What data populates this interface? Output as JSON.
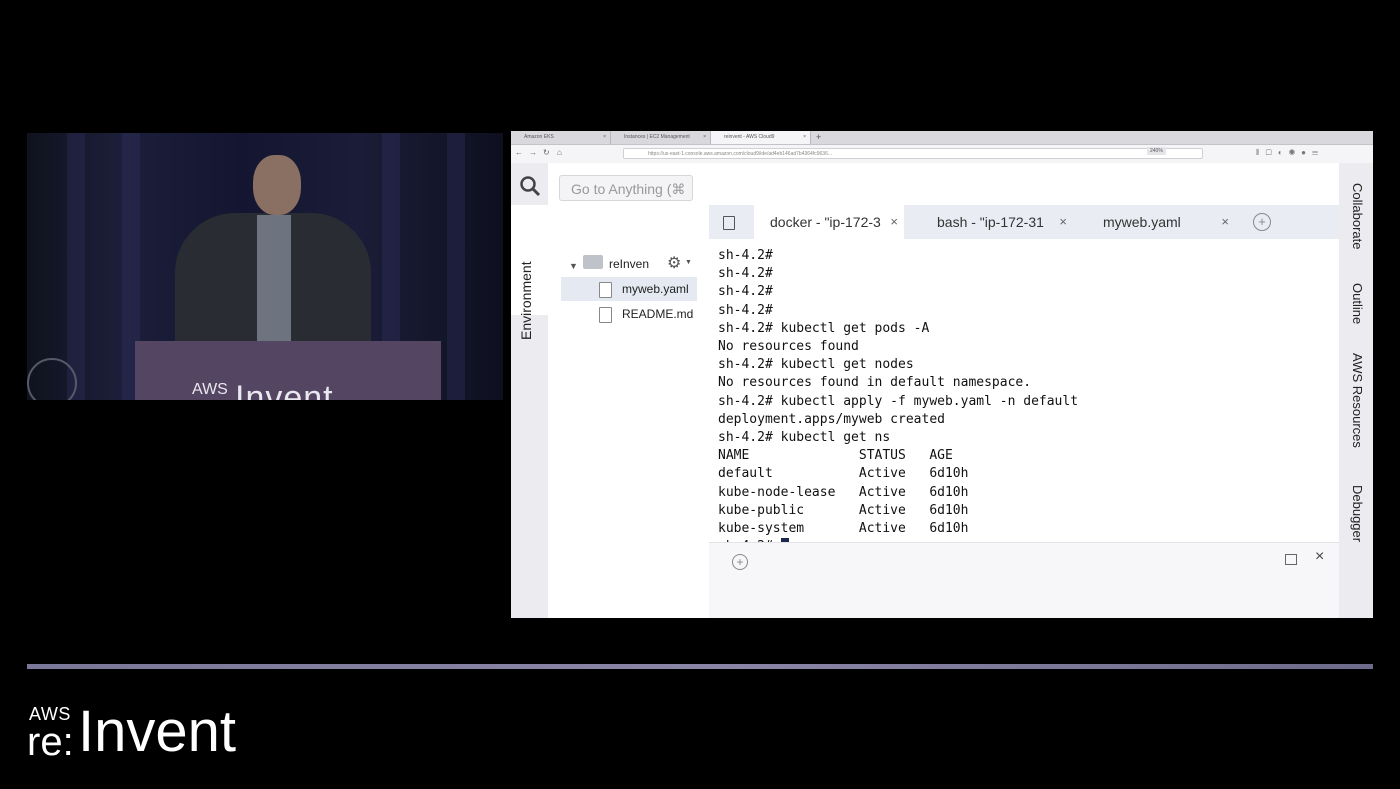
{
  "video": {
    "podium_aws": "AWS",
    "podium_invent": "Invent"
  },
  "browser": {
    "tabs": [
      {
        "label": "Amazon EKS"
      },
      {
        "label": "Instances | EC2 Management"
      },
      {
        "label": "reinvent - AWS Cloud9"
      }
    ],
    "url": "https://us-east-1.console.aws.amazon.com/cloud9/ide/ad4eb146ad7b4364fc9636..."
  },
  "ide": {
    "search_placeholder": "Go to Anything (⌘",
    "left_panel_label": "Environment",
    "tree": {
      "root": "reInven",
      "files": [
        "myweb.yaml",
        "README.md"
      ]
    },
    "tabs": [
      {
        "label": "docker - \"ip-172-3"
      },
      {
        "label": "bash - \"ip-172-31"
      },
      {
        "label": "myweb.yaml"
      }
    ],
    "terminal": {
      "lines": [
        "sh-4.2#",
        "sh-4.2#",
        "sh-4.2#",
        "sh-4.2#",
        "sh-4.2# kubectl get pods -A",
        "No resources found",
        "sh-4.2# kubectl get nodes",
        "No resources found in default namespace.",
        "sh-4.2# kubectl apply -f myweb.yaml -n default",
        "deployment.apps/myweb created",
        "sh-4.2# kubectl get ns",
        "NAME              STATUS   AGE",
        "default           Active   6d10h",
        "kube-node-lease   Active   6d10h",
        "kube-public       Active   6d10h",
        "kube-system       Active   6d10h"
      ],
      "prompt": "sh-4.2# "
    },
    "right_panels": [
      "Collaborate",
      "Outline",
      "AWS Resources",
      "Debugger"
    ]
  },
  "branding": {
    "aws": "AWS",
    "re": "re:",
    "invent": "Invent"
  }
}
